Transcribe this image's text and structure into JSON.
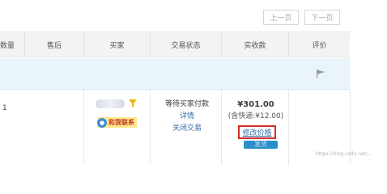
{
  "pager": {
    "prev_label": "上一页",
    "next_label": "下一页"
  },
  "table": {
    "headers": [
      "数量",
      "售后",
      "买家",
      "交易状态",
      "实收款",
      "评价"
    ]
  },
  "order": {
    "quantity": "1",
    "contact_label": "和我联系",
    "status": "等待买家付款",
    "detail_link": "详情",
    "close_link": "关闭交易",
    "amount": "¥301.00",
    "shipping": "(含快递:¥12.00)",
    "modify_price_link": "修改价格",
    "hidden_button_label": "发货"
  },
  "watermark": "https://blog.csdn.net/...",
  "colors": {
    "header_bg": "#f3f3f3",
    "order_bar_bg": "#eaf4fb",
    "highlight_box": "#d42b2b",
    "link": "#3a6ea5"
  },
  "icons": {
    "flag": "flag-icon",
    "filter": "filter-icon",
    "contact": "wangwang-icon"
  }
}
